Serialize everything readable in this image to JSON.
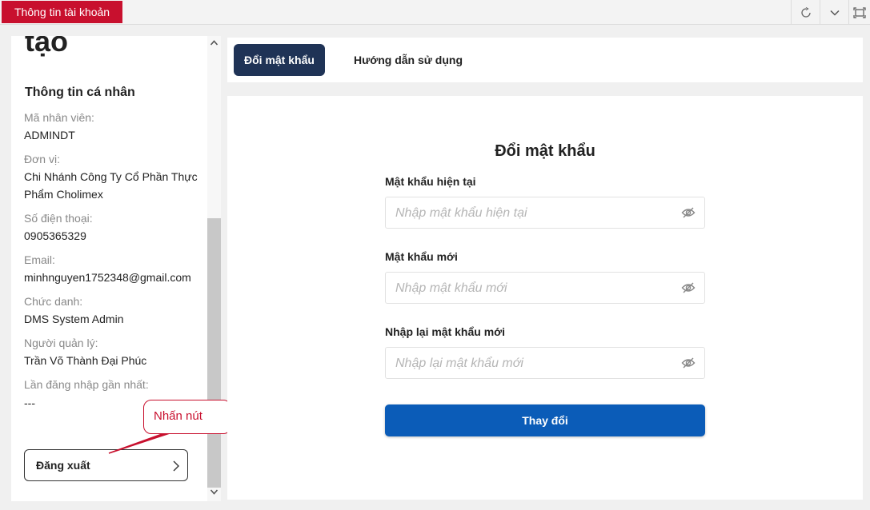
{
  "window": {
    "title": "Thông tin tài khoản",
    "controls": [
      "refresh-icon",
      "chevron-down-icon",
      "maximize-icon"
    ]
  },
  "profile": {
    "heading_fragment": "tạo",
    "section_title": "Thông tin cá nhân",
    "fields": [
      {
        "label": "Mã nhân viên:",
        "value": "ADMINDT"
      },
      {
        "label": "Đơn vị:",
        "value": "Chi Nhánh Công Ty Cổ Phần Thực Phẩm Cholimex"
      },
      {
        "label": "Số điện thoại:",
        "value": "0905365329"
      },
      {
        "label": "Email:",
        "value": "minhnguyen1752348@gmail.com"
      },
      {
        "label": "Chức danh:",
        "value": "DMS System Admin"
      },
      {
        "label": "Người quản lý:",
        "value": "Trần Võ Thành Đại Phúc"
      },
      {
        "label": "Lần đăng nhập gần nhất:",
        "value": "---"
      }
    ],
    "logout_label": "Đăng xuất"
  },
  "callout": {
    "text": "Nhấn nút",
    "color": "#c8102e"
  },
  "tabs": [
    {
      "label": "Đổi mật khẩu",
      "active": true
    },
    {
      "label": "Hướng dẫn sử dụng",
      "active": false
    }
  ],
  "form": {
    "title": "Đổi mật khẩu",
    "fields": [
      {
        "label": "Mật khẩu hiện tại",
        "placeholder": "Nhập mật khẩu hiện tại",
        "value": ""
      },
      {
        "label": "Mật khẩu mới",
        "placeholder": "Nhập mật khẩu mới",
        "value": ""
      },
      {
        "label": "Nhập lại mật khẩu mới",
        "placeholder": "Nhập lại mật khẩu mới",
        "value": ""
      }
    ],
    "submit_label": "Thay đổi"
  },
  "colors": {
    "brand_red": "#c8102e",
    "tab_active": "#1f3356",
    "primary_button": "#0b5cb8"
  }
}
